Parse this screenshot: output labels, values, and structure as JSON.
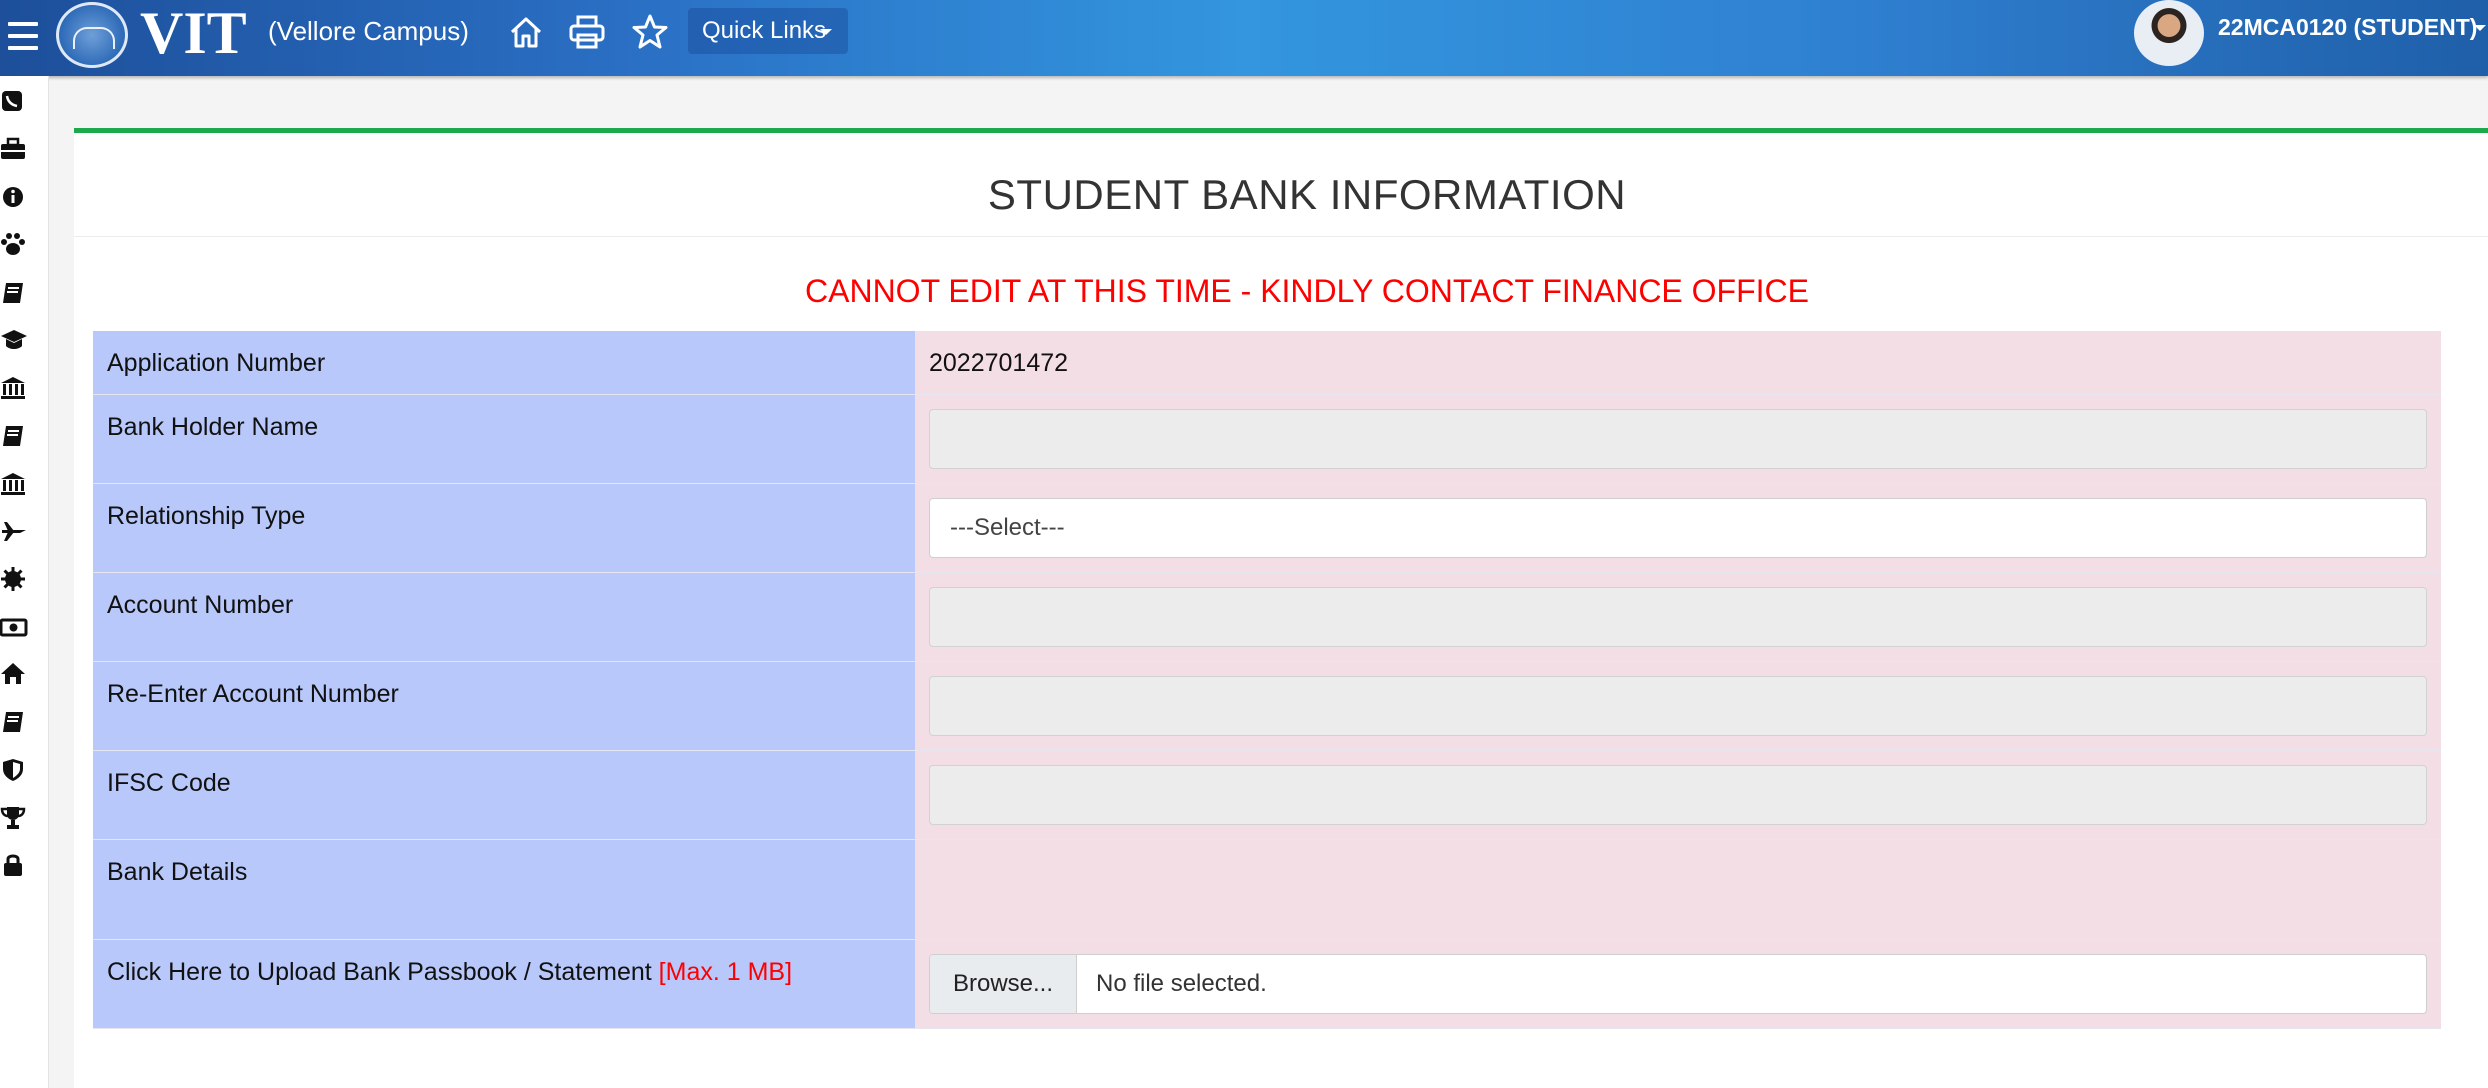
{
  "header": {
    "logo_text": "VIT",
    "campus": "(Vellore Campus)",
    "quick_links_label": "Quick Links",
    "user_label": "22MCA0120 (STUDENT)",
    "icons": [
      "menu-icon",
      "home-icon",
      "print-icon",
      "star-icon"
    ]
  },
  "sidebar": {
    "icons": [
      "phone-icon",
      "briefcase-icon",
      "info-icon",
      "paw-icon",
      "book-icon",
      "graduation-cap-icon",
      "bank-icon",
      "book-icon",
      "bank-icon",
      "plane-icon",
      "gear-icon",
      "money-icon",
      "home-icon",
      "book-icon",
      "shield-icon",
      "trophy-icon",
      "lock-icon"
    ]
  },
  "page": {
    "title": "STUDENT BANK INFORMATION",
    "warning": "CANNOT EDIT AT THIS TIME - KINDLY CONTACT FINANCE OFFICE",
    "accent_color": "#1ea84d",
    "warning_color": "#ff0000",
    "label_bg": "#b8c8fb",
    "value_bg": "#f4dee6"
  },
  "form": {
    "application_number": {
      "label": "Application Number",
      "value": "2022701472"
    },
    "bank_holder_name": {
      "label": "Bank Holder Name",
      "value": ""
    },
    "relationship_type": {
      "label": "Relationship Type",
      "selected": "---Select---"
    },
    "account_number": {
      "label": "Account Number",
      "value": ""
    },
    "reenter_account_number": {
      "label": "Re-Enter Account Number",
      "value": ""
    },
    "ifsc_code": {
      "label": "IFSC Code",
      "value": ""
    },
    "bank_details": {
      "label": "Bank Details",
      "value": ""
    },
    "upload": {
      "label": "Click Here to Upload Bank Passbook / Statement",
      "limit_note": "[Max. 1 MB]",
      "browse_label": "Browse...",
      "file_status": "No file selected."
    }
  }
}
